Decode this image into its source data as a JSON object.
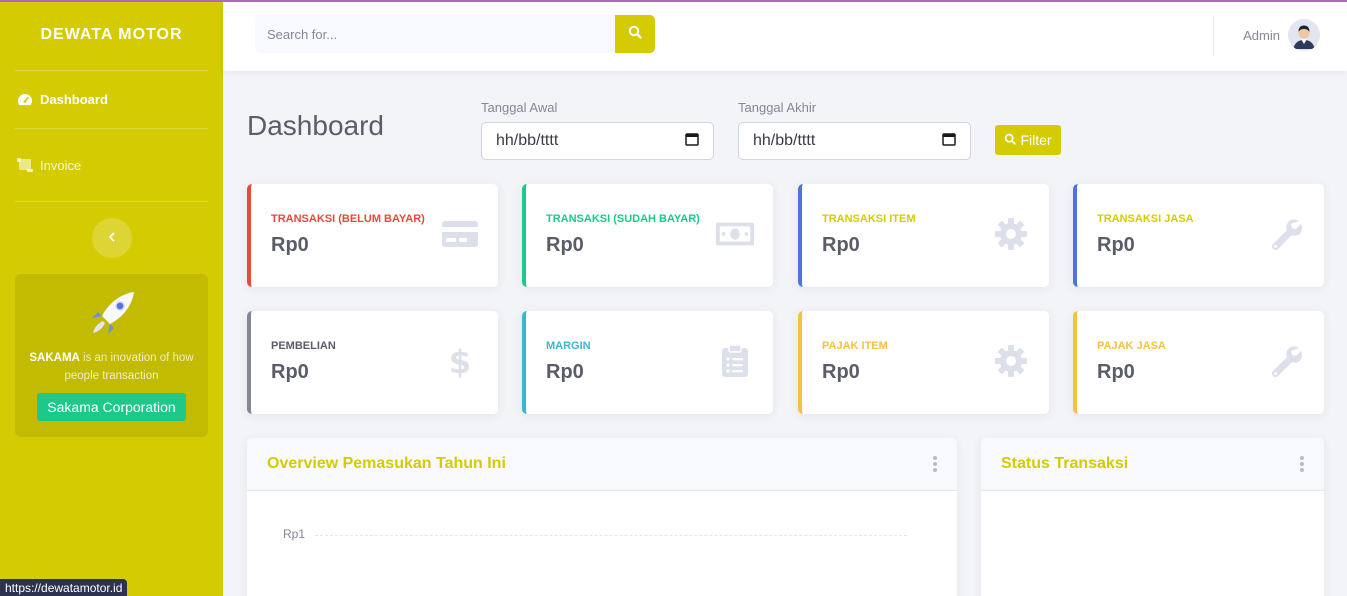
{
  "brand": "DEWATA MOTOR",
  "sidebar": {
    "items": [
      {
        "label": "Dashboard",
        "icon": "tachometer-icon"
      },
      {
        "label": "Invoice",
        "icon": "scroll-icon"
      }
    ],
    "toggle_icon": "chevron-left-icon",
    "promo": {
      "brand": "SAKAMA",
      "text": " is an inovation of how people transaction",
      "button": "Sakama Corporation"
    }
  },
  "status_url": "https://dewatamotor.id",
  "topbar": {
    "search_placeholder": "Search for...",
    "user_name": "Admin"
  },
  "page": {
    "title": "Dashboard",
    "start_label": "Tanggal Awal",
    "start_value": "hh/bb/tttt",
    "end_label": "Tanggal Akhir",
    "end_value": "hh/bb/tttt",
    "filter_label": "Filter"
  },
  "cards": [
    {
      "label": "TRANSAKSI (BELUM BAYAR)",
      "value": "Rp0",
      "color": "#e74a3b",
      "icon": "credit-card-icon"
    },
    {
      "label": "TRANSAKSI (SUDAH BAYAR)",
      "value": "Rp0",
      "color": "#1cc88a",
      "icon": "money-bill-icon"
    },
    {
      "label": "TRANSAKSI ITEM",
      "value": "Rp0",
      "color": "#d4cb02",
      "icon": "gear-icon"
    },
    {
      "label": "TRANSAKSI JASA",
      "value": "Rp0",
      "color": "#d4cb02",
      "icon": "wrench-icon"
    },
    {
      "label": "PEMBELIAN",
      "value": "Rp0",
      "color": "#5a5c69",
      "icon": "dollar-icon"
    },
    {
      "label": "MARGIN",
      "value": "Rp0",
      "color": "#36b9cc",
      "icon": "clipboard-list-icon"
    },
    {
      "label": "PAJAK ITEM",
      "value": "Rp0",
      "color": "#f6c23e",
      "icon": "gear-icon"
    },
    {
      "label": "PAJAK JASA",
      "value": "Rp0",
      "color": "#f6c23e",
      "icon": "wrench-icon"
    }
  ],
  "card_borders": [
    "#e74a3b",
    "#1cc88a",
    "#4e73df",
    "#4e73df",
    "#858796",
    "#36b9cc",
    "#f6c23e",
    "#f6c23e"
  ],
  "panels": {
    "overview_title": "Overview Pemasukan Tahun Ini",
    "overview_axis_label": "Rp1",
    "status_title": "Status Transaksi"
  }
}
